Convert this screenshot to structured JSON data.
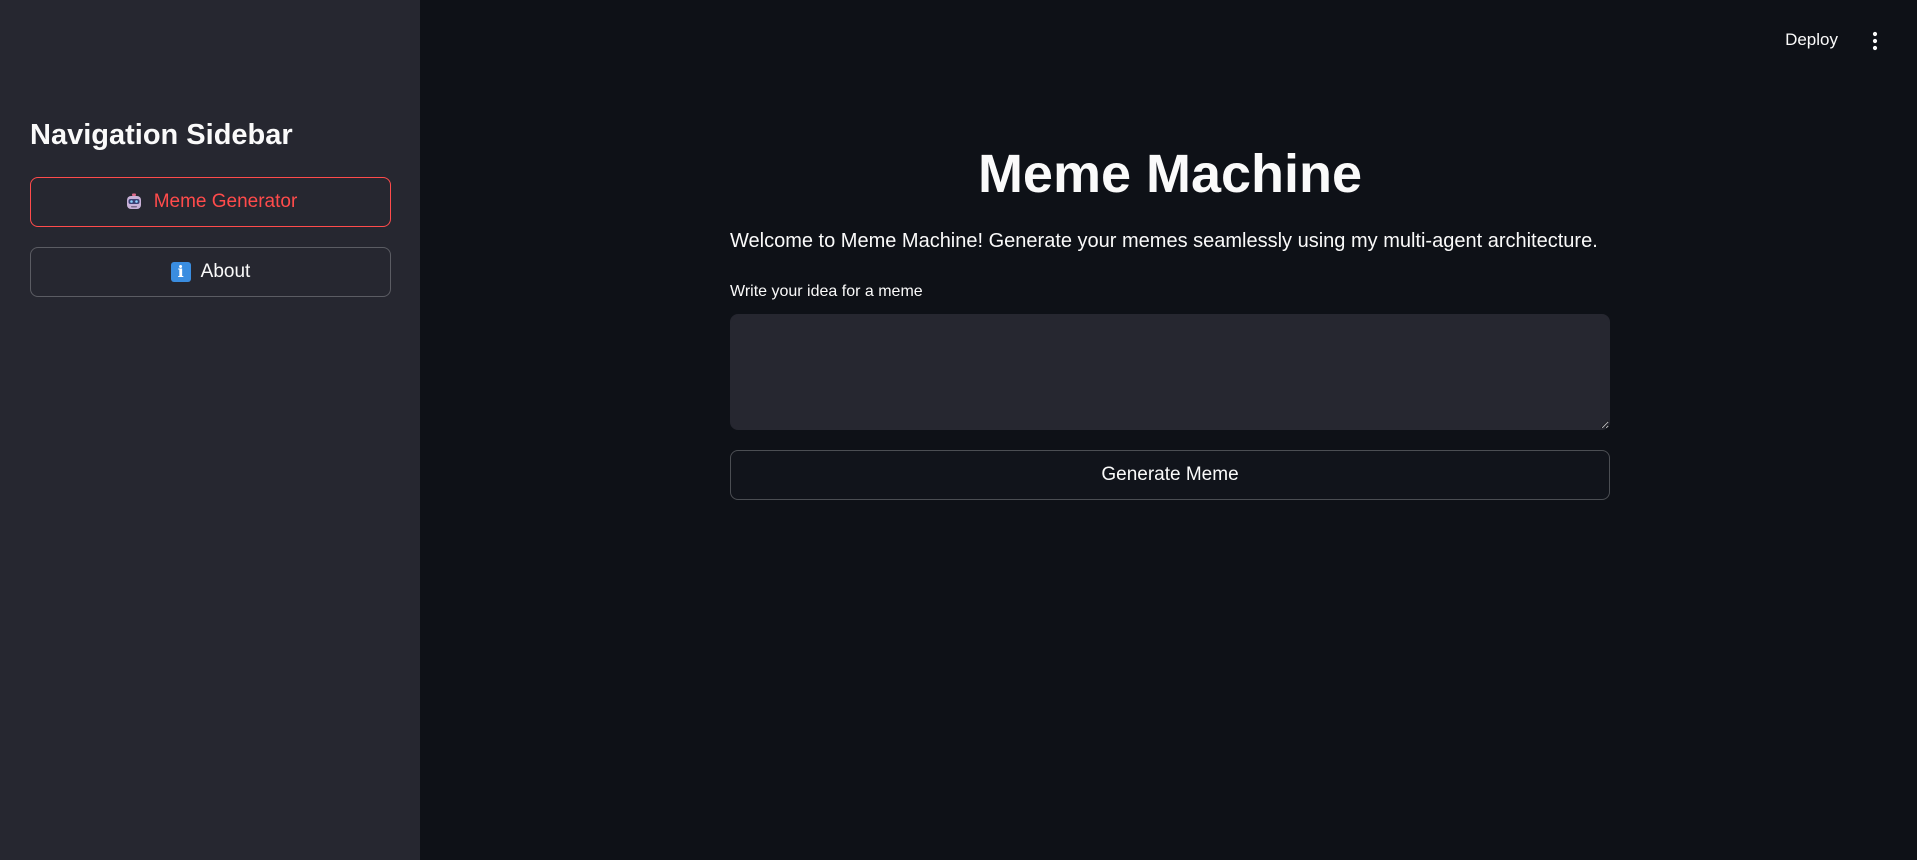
{
  "header": {
    "deploy_label": "Deploy",
    "menu_icon": "kebab-menu-icon"
  },
  "sidebar": {
    "title": "Navigation Sidebar",
    "items": [
      {
        "label": "Meme Generator",
        "icon": "robot-icon",
        "active": true
      },
      {
        "label": "About",
        "icon": "info-icon",
        "active": false
      }
    ]
  },
  "main": {
    "title": "Meme Machine",
    "welcome": "Welcome to Meme Machine! Generate your memes seamlessly using my multi-agent architecture.",
    "input_label": "Write your idea for a meme",
    "input_value": "",
    "generate_label": "Generate Meme"
  },
  "colors": {
    "background": "#0e1117",
    "sidebar": "#262730",
    "accent": "#ff4b4b",
    "text": "#fafafa"
  }
}
